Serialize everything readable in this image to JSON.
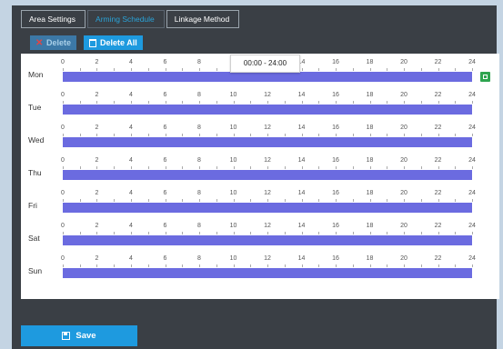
{
  "tabs": [
    "Area Settings",
    "Arming Schedule",
    "Linkage Method"
  ],
  "toolbar": {
    "delete_label": "Delete",
    "delete_all_label": "Delete All"
  },
  "hour_ticks": [
    "0",
    "2",
    "4",
    "6",
    "8",
    "10",
    "12",
    "14",
    "16",
    "18",
    "20",
    "22",
    "24"
  ],
  "days": [
    "Mon",
    "Tue",
    "Wed",
    "Thu",
    "Fri",
    "Sat",
    "Sun"
  ],
  "tooltip": "00:00 - 24:00",
  "save_label": "Save",
  "colors": {
    "accent": "#1e9adf",
    "schedule_bar": "#6b6be0",
    "copy_icon": "#2ea44f"
  }
}
